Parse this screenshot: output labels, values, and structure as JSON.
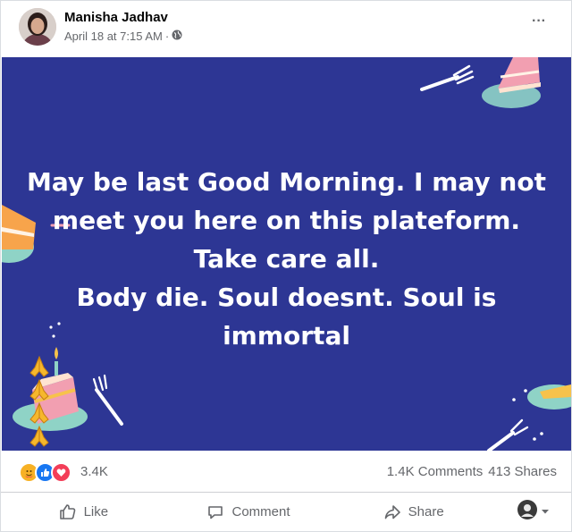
{
  "post": {
    "author": "Manisha Jadhav",
    "date": "April 18 at 7:15 AM",
    "separator": "·",
    "privacy_icon": "globe-icon",
    "more_label": "···"
  },
  "banner": {
    "background": "#2d3694",
    "lines": [
      "May be last Good Morning. I may not",
      "meet you here on this plateform.",
      "Take care all.",
      "Body die. Soul doesnt. Soul is",
      "immortal"
    ],
    "emoji_icon": "folded-hands-icon",
    "emoji_count": 4
  },
  "stats": {
    "reaction_icons": [
      "care-icon",
      "like-icon",
      "love-icon"
    ],
    "reaction_count": "3.4K",
    "comments": "1.4K Comments",
    "shares": "413 Shares"
  },
  "actions": {
    "like": "Like",
    "comment": "Comment",
    "share": "Share"
  },
  "colors": {
    "like_blue": "#1877f2",
    "love_red": "#f33e58",
    "care_yellow": "#f7b125",
    "secondary_text": "#65676b"
  }
}
